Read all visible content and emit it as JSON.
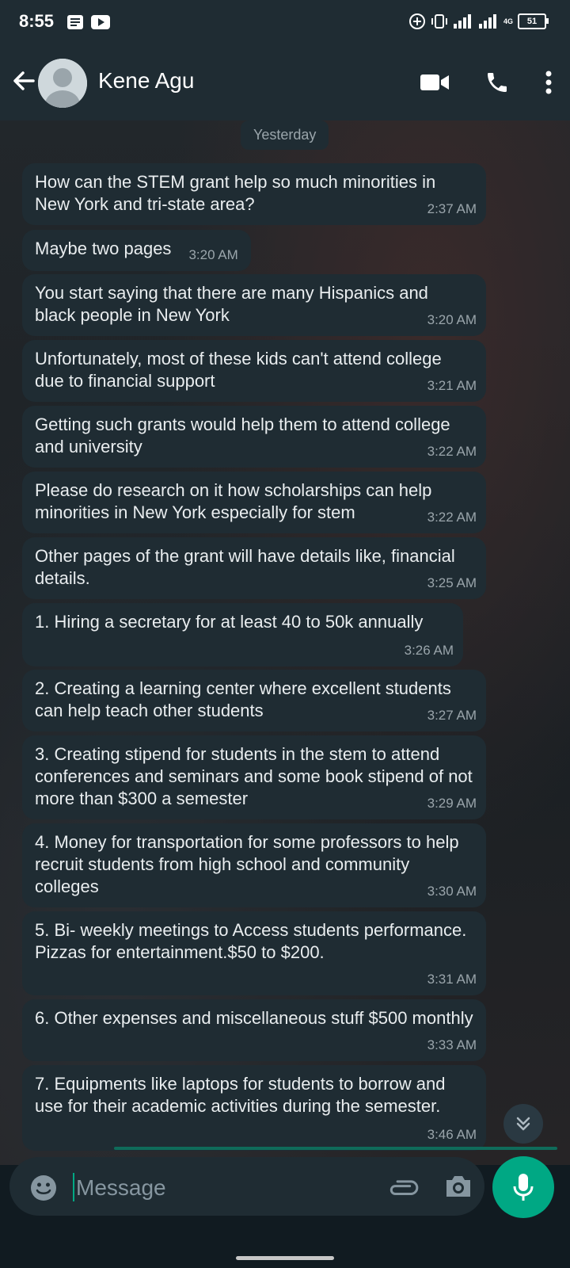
{
  "status_bar": {
    "time": "8:55",
    "battery": "51",
    "network": "4G"
  },
  "header": {
    "contact_name": "Kene Agu"
  },
  "date_chip": "Yesterday",
  "messages": [
    {
      "text": "How can the STEM grant help so much minorities in New York and tri-state area?",
      "time": "2:37 AM"
    },
    {
      "text": "Maybe two pages",
      "time": "3:20 AM"
    },
    {
      "text": "You start saying that there are many Hispanics and black people in New York",
      "time": "3:20 AM"
    },
    {
      "text": "Unfortunately, most of these kids can't attend college due to financial support",
      "time": "3:21 AM"
    },
    {
      "text": "Getting such grants would help them to attend college and university",
      "time": "3:22 AM"
    },
    {
      "text": "Please do research on it how scholarships can help minorities in New York especially for stem",
      "time": "3:22 AM"
    },
    {
      "text": "Other pages of the grant will have details like, financial details.",
      "time": "3:25 AM"
    },
    {
      "text": "1. Hiring a secretary for at least 40 to 50k annually",
      "time": "3:26 AM"
    },
    {
      "text": "2. Creating a learning center where excellent students can help teach other students",
      "time": "3:27 AM"
    },
    {
      "text": "3. Creating stipend for students in the stem to attend conferences and seminars and some book stipend of not more than $300 a semester",
      "time": "3:29 AM"
    },
    {
      "text": "4. Money for transportation for some professors to help recruit students from high school and community colleges",
      "time": "3:30 AM"
    },
    {
      "text": "5. Bi- weekly meetings   to Access students performance. Pizzas for entertainment.$50 to $200.",
      "time": "3:31 AM"
    },
    {
      "text": "6. Other expenses and miscellaneous stuff $500 monthly",
      "time": "3:33 AM"
    },
    {
      "text": "7. Equipments like laptops for students to borrow and use for their academic activities during the semester.",
      "time": "3:46 AM"
    }
  ],
  "composer": {
    "placeholder": "Message"
  },
  "colors": {
    "accent": "#00a884",
    "bubble": "#1f2c33",
    "bar": "#1f2c33"
  },
  "icons": [
    "back-arrow-icon",
    "video-call-icon",
    "voice-call-icon",
    "more-options-icon",
    "emoji-icon",
    "attach-icon",
    "camera-icon",
    "mic-icon",
    "scroll-down-icon"
  ]
}
